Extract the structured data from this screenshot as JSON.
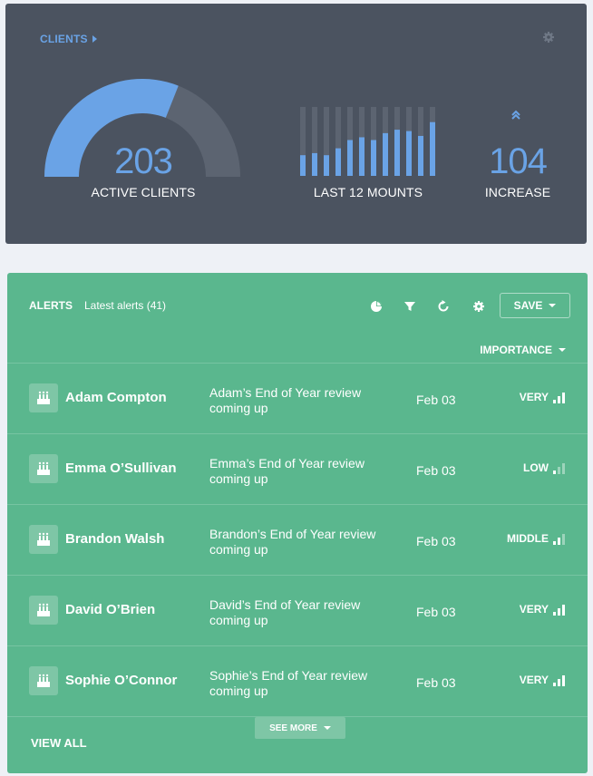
{
  "clients": {
    "link_label": "CLIENTS",
    "accent": "#6aa3e6",
    "active_clients": {
      "value": "203",
      "label": "ACTIVE CLIENTS",
      "gauge_fraction": 0.62
    },
    "monthly": {
      "label": "LAST 12 MOUNTS",
      "values": [
        0.3,
        0.33,
        0.3,
        0.4,
        0.52,
        0.56,
        0.52,
        0.62,
        0.67,
        0.65,
        0.58,
        0.78
      ]
    },
    "increase": {
      "value": "104",
      "label": "INCREASE"
    }
  },
  "alerts": {
    "title": "ALERTS",
    "subtitle": "Latest alerts (41)",
    "save_label": "SAVE",
    "sort_label": "IMPORTANCE",
    "rows": [
      {
        "name": "Adam Compton",
        "message": "Adam’s End of Year review coming up",
        "date": "Feb 03",
        "level": "VERY",
        "bars": 3
      },
      {
        "name": "Emma O’Sullivan",
        "message": "Emma’s End of Year review coming up",
        "date": "Feb 03",
        "level": "LOW",
        "bars": 1
      },
      {
        "name": "Brandon Walsh",
        "message": "Brandon’s End of Year review coming up",
        "date": "Feb 03",
        "level": "MIDDLE",
        "bars": 2
      },
      {
        "name": "David O’Brien",
        "message": "David’s End of Year review coming up",
        "date": "Feb 03",
        "level": "VERY",
        "bars": 3
      },
      {
        "name": "Sophie O’Connor",
        "message": "Sophie’s End of Year review coming up",
        "date": "Feb 03",
        "level": "VERY",
        "bars": 3
      }
    ],
    "view_all_label": "VIEW ALL",
    "see_more_label": "SEE MORE"
  }
}
